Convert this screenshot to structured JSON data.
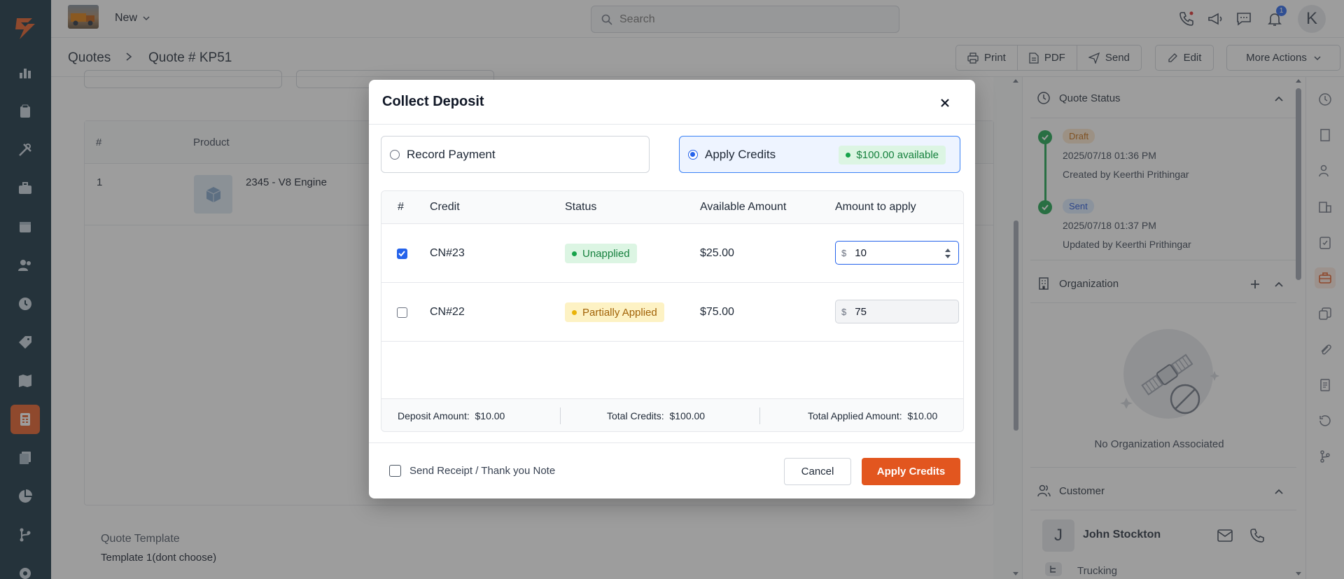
{
  "topbar": {
    "new_label": "New",
    "search_placeholder": "Search",
    "notification_count": "1",
    "avatar_initial": "K"
  },
  "breadcrumb": {
    "parent": "Quotes",
    "current": "Quote # KP51"
  },
  "actions": {
    "print": "Print",
    "pdf": "PDF",
    "send": "Send",
    "edit": "Edit",
    "more": "More Actions"
  },
  "products": {
    "headers": [
      "#",
      "Product"
    ],
    "rows": [
      {
        "num": "1",
        "name": "2345 - V8 Engine"
      }
    ]
  },
  "template": {
    "label": "Quote Template",
    "value": "Template 1(dont choose)"
  },
  "right_panel": {
    "quote_status_title": "Quote Status",
    "timeline": [
      {
        "status": "Draft",
        "time": "2025/07/18 01:36 PM",
        "by": "Created by Keerthi Prithingar"
      },
      {
        "status": "Sent",
        "time": "2025/07/18 01:37 PM",
        "by": "Updated by Keerthi Prithingar"
      }
    ],
    "organization_title": "Organization",
    "no_org_text": "No Organization Associated",
    "customer_title": "Customer",
    "customer": {
      "initial": "J",
      "name": "John Stockton",
      "sub": "Trucking"
    }
  },
  "modal": {
    "title": "Collect Deposit",
    "option_record": "Record Payment",
    "option_apply": "Apply Credits",
    "available": "$100.00 available",
    "headers": {
      "num": "#",
      "credit": "Credit",
      "status": "Status",
      "available": "Available Amount",
      "apply": "Amount to apply"
    },
    "rows": [
      {
        "credit": "CN#23",
        "status": "Unapplied",
        "available": "$25.00",
        "currency": "$",
        "amount": "10",
        "checked": true
      },
      {
        "credit": "CN#22",
        "status": "Partially Applied",
        "available": "$75.00",
        "currency": "$",
        "amount": "75",
        "checked": false
      }
    ],
    "footer": {
      "deposit_label": "Deposit Amount:",
      "deposit_value": "$10.00",
      "credits_label": "Total Credits:",
      "credits_value": "$100.00",
      "applied_label": "Total Applied Amount:",
      "applied_value": "$10.00"
    },
    "receipt_label": "Send Receipt / Thank you Note",
    "cancel": "Cancel",
    "apply": "Apply Credits"
  },
  "colors": {
    "brand": "#e2561f",
    "nav_bg": "#0f2b3a",
    "accent": "#2563eb",
    "success": "#16a34a"
  }
}
